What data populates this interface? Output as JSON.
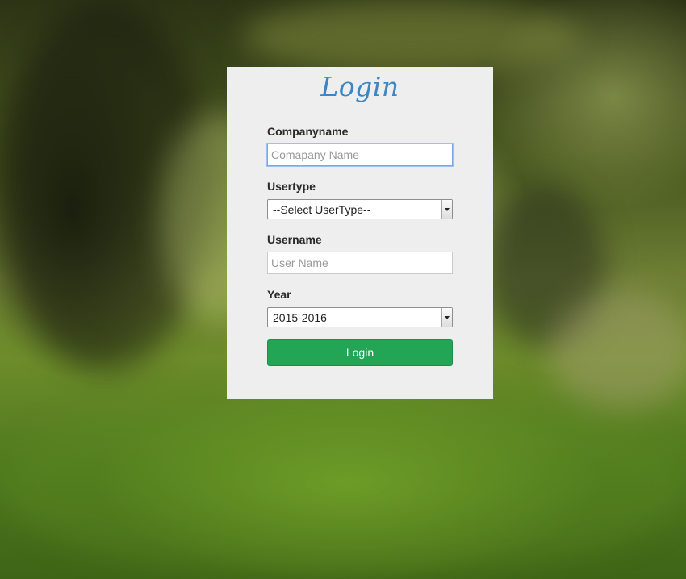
{
  "form": {
    "title": "Login",
    "company": {
      "label": "Companyname",
      "placeholder": "Comapany Name",
      "value": ""
    },
    "usertype": {
      "label": "Usertype",
      "selected": "--Select UserType--"
    },
    "username": {
      "label": "Username",
      "placeholder": "User Name",
      "value": ""
    },
    "year": {
      "label": "Year",
      "selected": "2015-2016"
    },
    "submit_label": "Login"
  },
  "colors": {
    "title": "#3b86c6",
    "panel": "#eeeeee",
    "button": "#22a554",
    "focus_border": "#7aa7e6"
  },
  "icons": {
    "select_arrow": "chevron-down-icon"
  }
}
